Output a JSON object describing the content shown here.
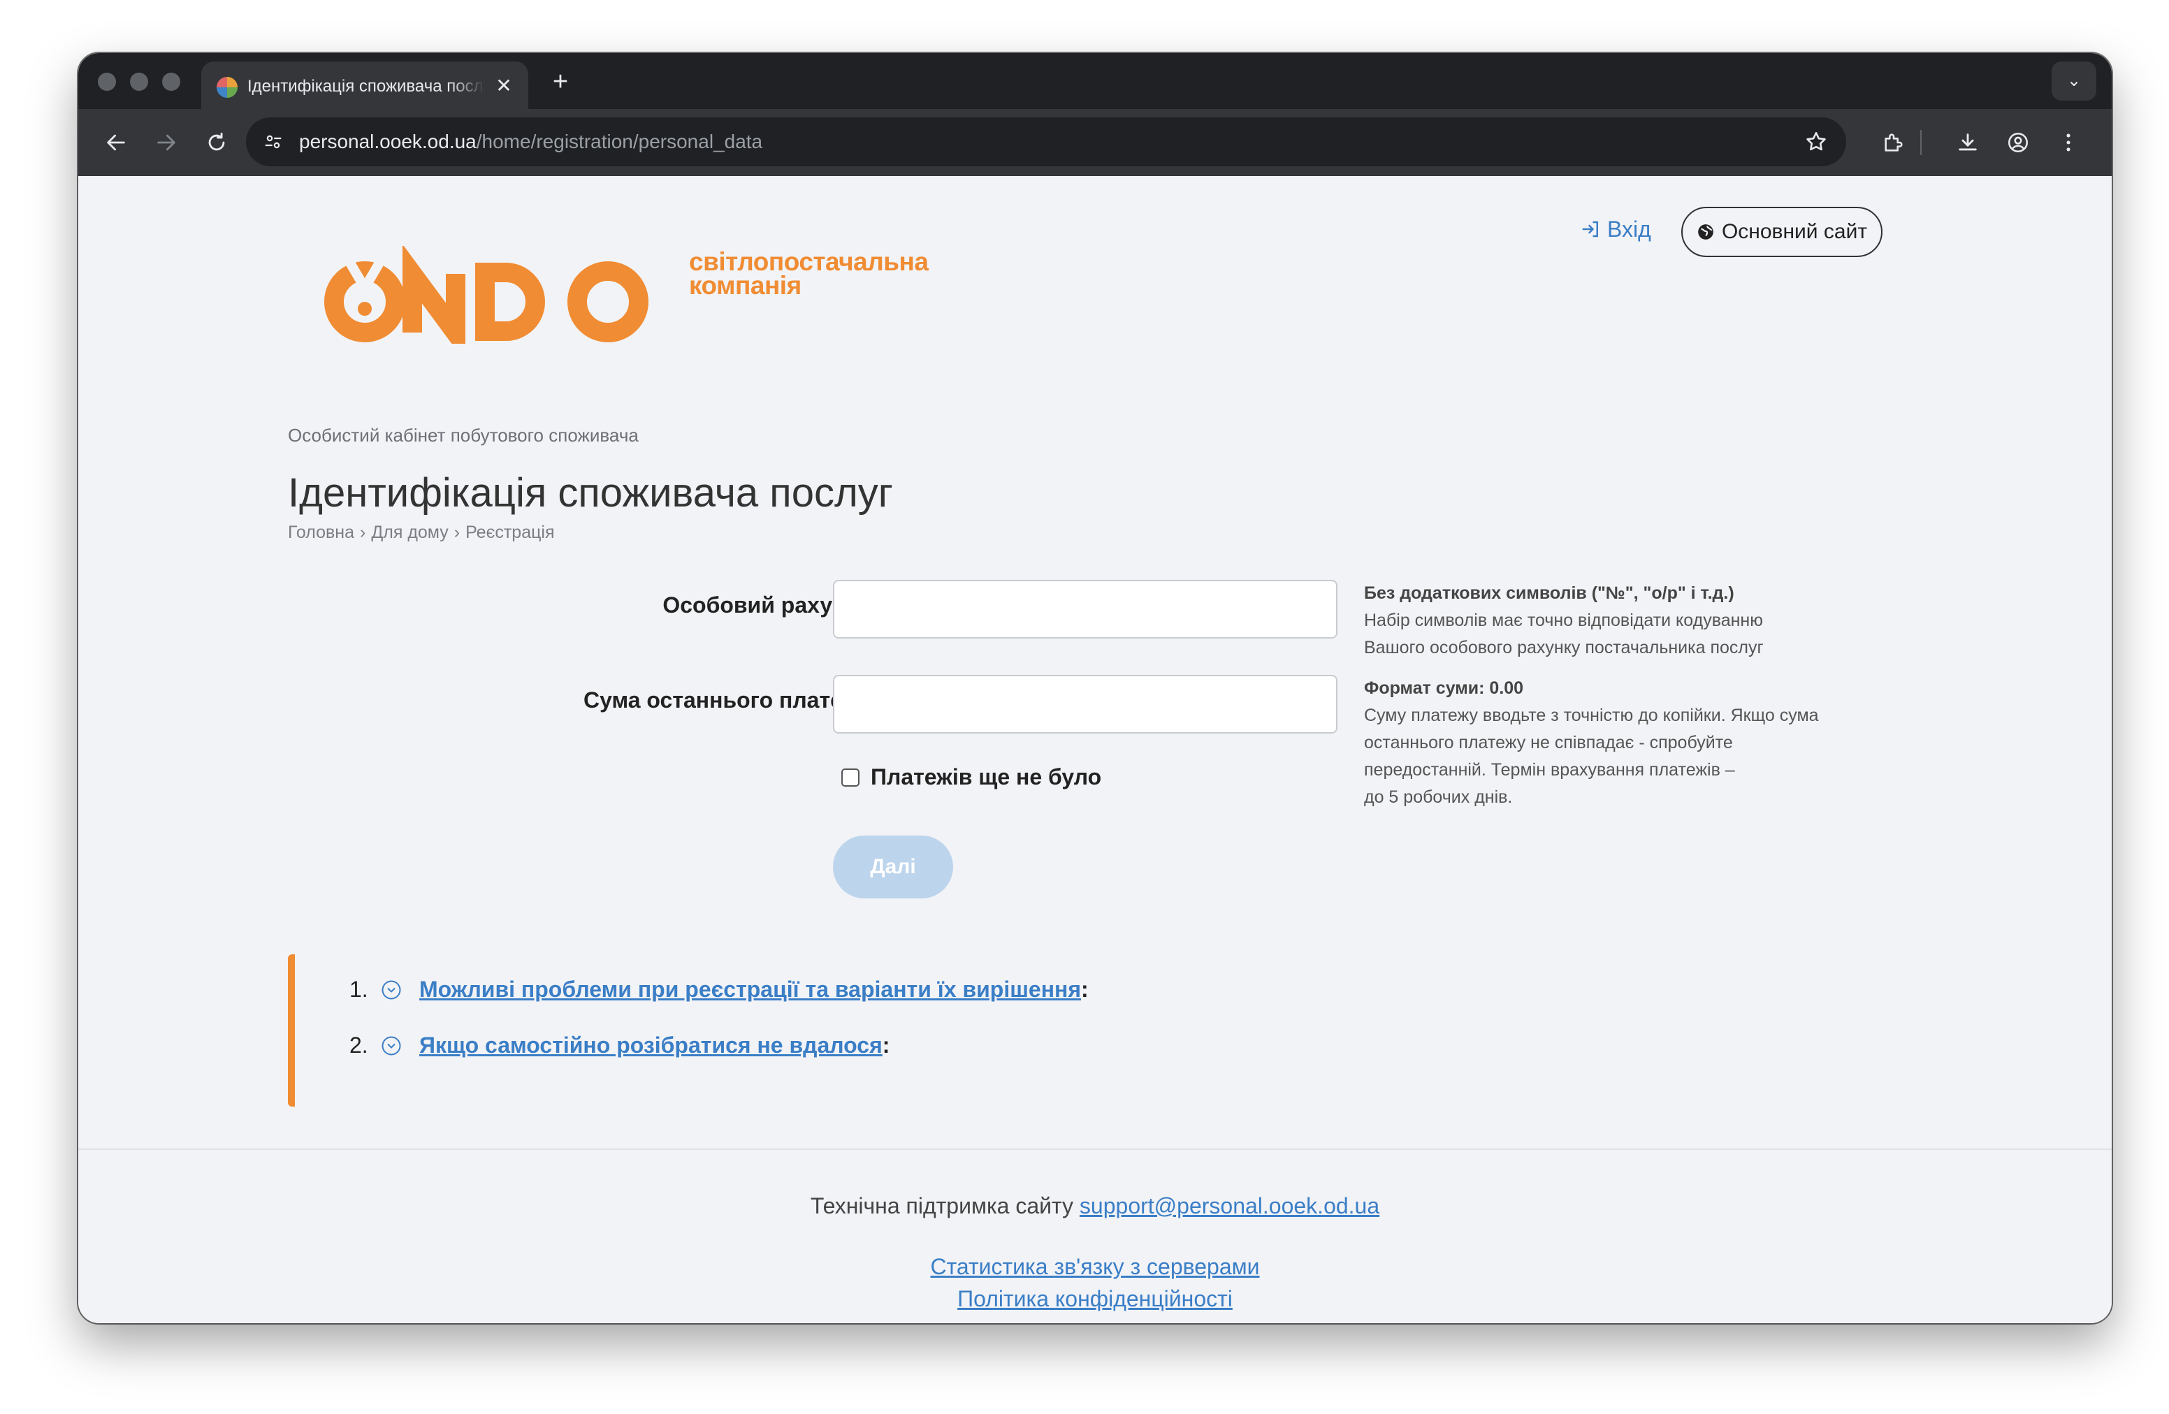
{
  "browser": {
    "tab_title": "Ідентифікація споживача послуг",
    "url_host": "personal.ooek.od.ua",
    "url_path": "/home/registration/personal_data"
  },
  "header": {
    "login_label": "Вхід",
    "main_site_label": "Основний сайт",
    "logo_tagline_line1": "світлопостачальна",
    "logo_tagline_line2": "компанія",
    "logo_wordmark": "ONDO"
  },
  "page": {
    "subtitle": "Особистий кабінет побутового споживача",
    "title": "Ідентифікація споживача послуг",
    "breadcrumb": [
      "Головна",
      "›",
      "Для дому",
      "›",
      "Реєстрація"
    ]
  },
  "form": {
    "account_label": "Особовий рахунок",
    "account_value": "",
    "payment_label": "Сума останнього платежу",
    "payment_value": "",
    "no_payments_label": "Платежів ще не було",
    "no_payments_checked": false,
    "next_label": "Далі",
    "account_hint_title": "Без додаткових символів (\"№\", \"о/р\" і т.д.)",
    "account_hint_lines": [
      "Набір символів має точно відповідати кодуванню",
      "Вашого особового рахунку постачальника послуг"
    ],
    "payment_hint_title": "Формат суми: 0.00",
    "payment_hint_lines": [
      "Суму платежу вводьте з точністю до копійки. Якщо сума",
      "останнього платежу не співпадає - спробуйте",
      "передостанній. Термін врахування платежів –",
      "до 5 робочих днів."
    ]
  },
  "faq": {
    "items": [
      {
        "num": "1.",
        "label": "Можливі проблеми при реєстрації та варіанти їх вирішення"
      },
      {
        "num": "2.",
        "label": "Якщо самостійно розібратися не вдалося"
      }
    ],
    "colon": ":"
  },
  "footer": {
    "support_text": "Технічна підтримка сайту",
    "support_email": "support@personal.ooek.od.ua",
    "stats_link": "Статистика зв'язку з серверами",
    "privacy_link": "Політика конфіденційності"
  },
  "colors": {
    "accent_orange": "#f08c33",
    "link_blue": "#3a7ec6",
    "button_disabled": "#bcd4ec"
  }
}
